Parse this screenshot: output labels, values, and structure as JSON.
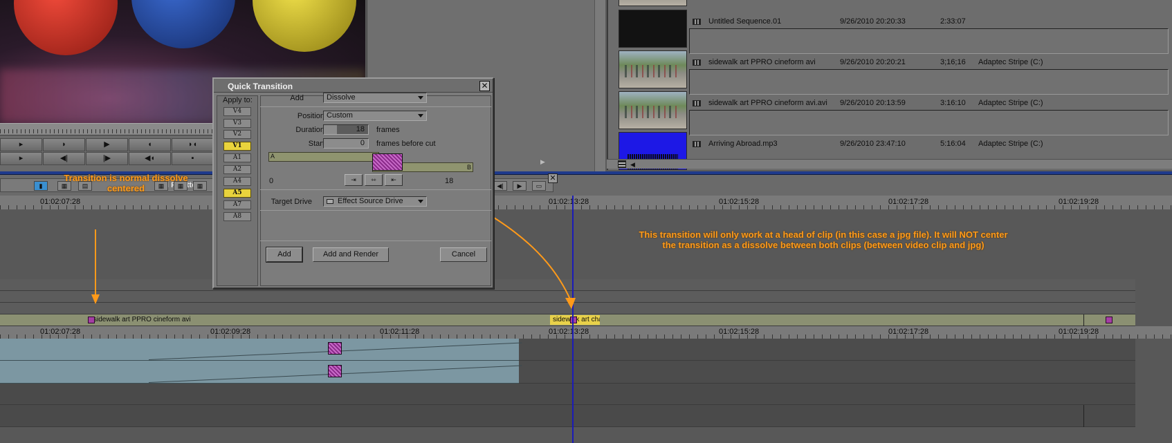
{
  "annotations": {
    "left_note": "Transition is normal dissolve centered",
    "right_note_line1": "This transition will only work at a head of clip (in this case a jpg file).  It will NOT center",
    "right_note_line2": "the transition as a dissolve between both clips (between video clip and jpg)",
    "color": "#ff9a1a"
  },
  "bin": {
    "items": [
      {
        "name": "Untitled Sequence.01",
        "date": "9/26/2010 20:20:33",
        "duration": "2:33:07",
        "drive": "",
        "thumb": "dark"
      },
      {
        "name": "sidewalk art PPRO cineform avi",
        "date": "9/26/2010 20:20:21",
        "duration": "3;16;16",
        "drive": "Adaptec Stripe (C:)",
        "thumb": "street"
      },
      {
        "name": "sidewalk art PPRO cineform avi.avi",
        "date": "9/26/2010 20:13:59",
        "duration": "3:16:10",
        "drive": "Adaptec Stripe (C:)",
        "thumb": "street"
      },
      {
        "name": "Arriving Abroad.mp3",
        "date": "9/26/2010 23:47:10",
        "duration": "5:16:04",
        "drive": "Adaptec Stripe (C:)",
        "thumb": "audio"
      }
    ]
  },
  "palette": {
    "title": "l Palette"
  },
  "ruler": {
    "timecodes": [
      "01:02:07:28",
      "01:02:09:28",
      "01:02:11:28",
      "01:02:13:28",
      "01:02:15:28",
      "01:02:17:28",
      "01:02:19:28"
    ]
  },
  "timeline": {
    "clip_a": "sidewalk art PPRO cineform avi",
    "clip_b": "sidewalk art chalk jpg.jpg"
  },
  "dialog": {
    "title": "Quick Transition",
    "apply_to_label": "Apply to:",
    "tracks": [
      {
        "label": "V4",
        "on": false
      },
      {
        "label": "V3",
        "on": false
      },
      {
        "label": "V2",
        "on": false
      },
      {
        "label": "V1",
        "on": true
      },
      {
        "label": "A1",
        "on": false
      },
      {
        "label": "A2",
        "on": false
      },
      {
        "label": "A4",
        "on": false
      },
      {
        "label": "A5",
        "on": true
      },
      {
        "label": "A7",
        "on": false
      },
      {
        "label": "A8",
        "on": false
      }
    ],
    "add_label": "Add",
    "add_value": "Dissolve",
    "position_label": "Position",
    "position_value": "Custom",
    "duration_label": "Duration",
    "duration_value": "18",
    "duration_unit": "frames",
    "start_label": "Start",
    "start_value": "0",
    "start_unit": "frames before cut",
    "graph_a": "A",
    "graph_b": "B",
    "range_min": "0",
    "range_max": "18",
    "target_drive_label": "Target Drive",
    "target_drive_value": "Effect Source Drive",
    "btn_add": "Add",
    "btn_add_render": "Add and Render",
    "btn_cancel": "Cancel",
    "close_glyph": "✕"
  }
}
